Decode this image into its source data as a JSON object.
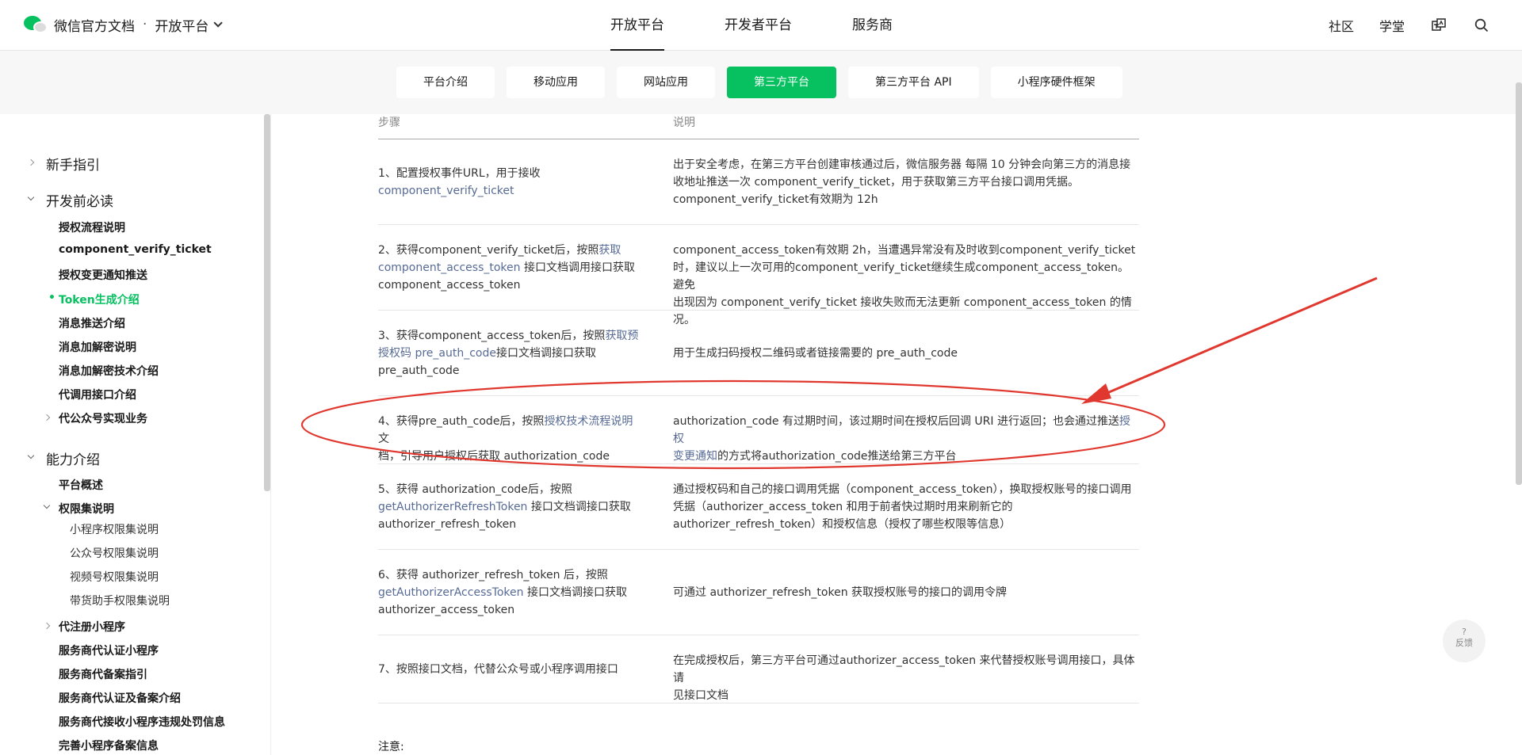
{
  "header": {
    "brand": "微信官方文档",
    "separator": "·",
    "platform": "开放平台",
    "nav": [
      "开放平台",
      "开发者平台",
      "服务商"
    ],
    "right_links": [
      "社区",
      "学堂"
    ],
    "icons": [
      "translate-icon",
      "search-icon"
    ]
  },
  "subtabs": [
    "平台介绍",
    "移动应用",
    "网站应用",
    "第三方平台",
    "第三方平台 API",
    "小程序硬件框架"
  ],
  "sidebar": {
    "sections": [
      {
        "label": "新手指引"
      },
      {
        "label": "开发前必读"
      },
      {
        "label": "能力介绍"
      }
    ],
    "items": [
      "授权流程说明",
      "component_verify_ticket",
      "授权变更通知推送",
      "Token生成介绍",
      "消息推送介绍",
      "消息加解密说明",
      "消息加解密技术介绍",
      "代调用接口介绍",
      "代公众号实现业务",
      "平台概述",
      "权限集说明",
      "小程序权限集说明",
      "公众号权限集说明",
      "视频号权限集说明",
      "带货助手权限集说明",
      "代注册小程序",
      "服务商代认证小程序",
      "服务商代备案指引",
      "服务商代认证及备案介绍",
      "服务商代接收小程序违规处罚信息",
      "完善小程序备案信息"
    ]
  },
  "table": {
    "headers": [
      "步骤",
      "说明"
    ],
    "rows": [
      {
        "step": [
          "1、配置授权事件URL，用于接收",
          "component_verify_ticket"
        ],
        "desc": [
          "出于安全考虑，在第三方平台创建审核通过后，微信服务器 每隔 10 分钟会向第三方的消息接",
          "收地址推送一次 component_verify_ticket，用于获取第三方平台接口调用凭据。",
          "component_verify_ticket有效期为 12h"
        ]
      },
      {
        "step": [
          "2、获得component_verify_ticket后，按照",
          "获取",
          "component_access_token",
          " 接口文档调用接口获取",
          "component_access_token"
        ],
        "desc": [
          "component_access_token有效期 2h，当遭遇异常没有及时收到component_verify_ticket",
          "时，建议以上一次可用的component_verify_ticket继续生成component_access_token。避免",
          "出现因为 component_verify_ticket 接收失败而无法更新 component_access_token 的情况。"
        ]
      },
      {
        "step": [
          "3、获得component_access_token后，按照",
          "获取预",
          "授权码 pre_auth_code",
          "接口文档调接口获取",
          "pre_auth_code"
        ],
        "desc": [
          "用于生成扫码授权二维码或者链接需要的 pre_auth_code"
        ]
      },
      {
        "step": [
          "4、获得pre_auth_code后，按照",
          "授权技术流程说明",
          "文",
          "档，引导用户授权后获取 authorization_code"
        ],
        "desc": [
          "authorization_code 有过期时间，该过期时间在授权后回调 URI 进行返回；也会通过推送",
          "授权",
          "变更通知",
          "的方式将authorization_code推送给第三方平台"
        ]
      },
      {
        "step": [
          "5、获得 authorization_code后，按照",
          "getAuthorizerRefreshToken",
          " 接口文档调接口获取",
          "authorizer_refresh_token"
        ],
        "desc": [
          "通过授权码和自己的接口调用凭据（component_access_token），换取授权账号的接口调用",
          "凭据（authorizer_access_token 和用于前者快过期时用来刷新它的",
          "authorizer_refresh_token）和授权信息（授权了哪些权限等信息）"
        ]
      },
      {
        "step": [
          "6、获得 authorizer_refresh_token 后，按照",
          "getAuthorizerAccessToken",
          " 接口文档调接口获取",
          "authorizer_access_token"
        ],
        "desc": [
          "可通过 authorizer_refresh_token 获取授权账号的接口的调用令牌"
        ]
      },
      {
        "step": [
          "7、按照接口文档，代替公众号或小程序调用接口"
        ],
        "desc": [
          "在完成授权后，第三方平台可通过authorizer_access_token 来代替授权账号调用接口，具体请",
          "见接口文档"
        ]
      }
    ],
    "note": "注意:"
  },
  "feedback": {
    "symbol": "?",
    "label": "反馈"
  },
  "annotation_color": "#e0382f",
  "accent": "#07c160",
  "link_color": "#576b95"
}
